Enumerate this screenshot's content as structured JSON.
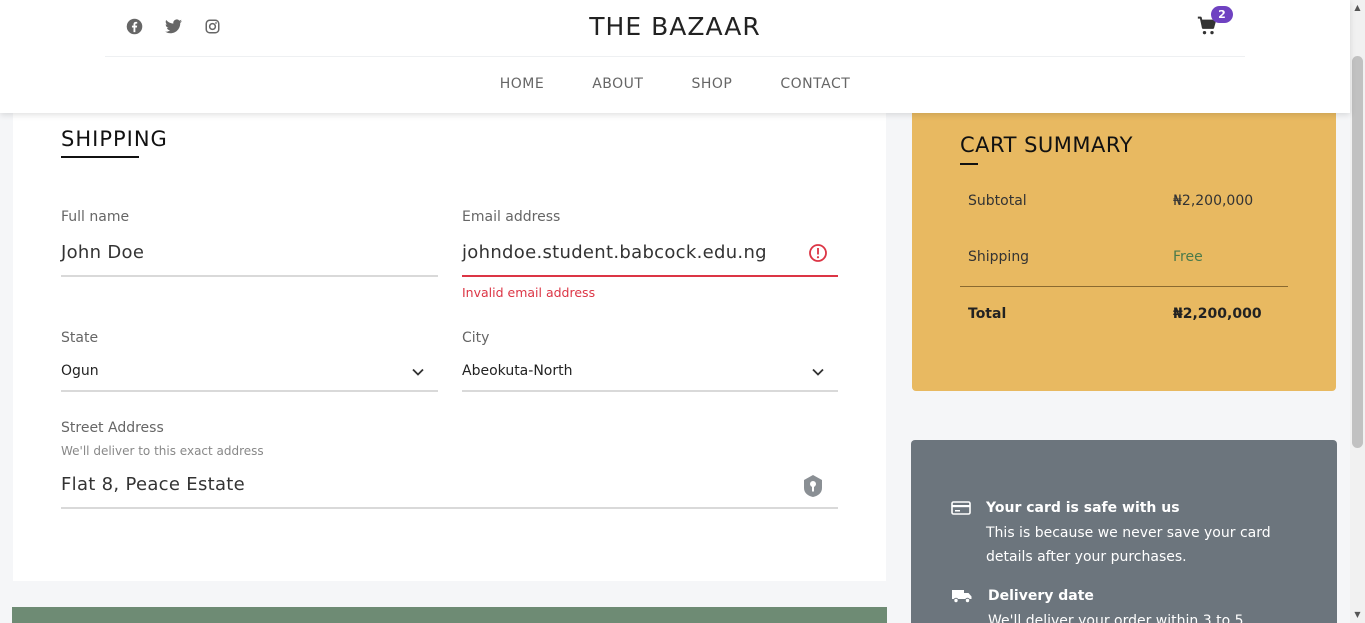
{
  "header": {
    "brand": "THE BAZAAR",
    "social_icons": [
      "facebook-icon",
      "twitter-icon",
      "instagram-icon"
    ],
    "cart_count": "2",
    "nav": [
      "HOME",
      "ABOUT",
      "SHOP",
      "CONTACT"
    ]
  },
  "shipping": {
    "title": "SHIPPING",
    "full_name": {
      "label": "Full name",
      "value": "John Doe"
    },
    "email": {
      "label": "Email address",
      "value": "johndoe.student.babcock.edu.ng",
      "error": "Invalid email address"
    },
    "state": {
      "label": "State",
      "value": "Ogun"
    },
    "city": {
      "label": "City",
      "value": "Abeokuta-North"
    },
    "street": {
      "label": "Street Address",
      "hint": "We'll deliver to this exact address",
      "value": "Flat 8, Peace Estate"
    }
  },
  "summary": {
    "title": "CART SUMMARY",
    "rows": [
      {
        "label": "Subtotal",
        "value": "₦2,200,000"
      },
      {
        "label": "Shipping",
        "value": "Free"
      },
      {
        "label": "Total",
        "value": "₦2,200,000"
      }
    ]
  },
  "info": {
    "card_title": "Your card is safe with us",
    "card_body": "This is because we never save your card details after your purchases.",
    "delivery_title": "Delivery date",
    "delivery_body": "We'll deliver your order within 3 to 5"
  },
  "colors": {
    "accent_badge": "#6f42c1",
    "summary_bg": "#e8b961",
    "info_bg": "#6c757d",
    "error": "#dc3545",
    "green_bar": "#6e8b74"
  }
}
